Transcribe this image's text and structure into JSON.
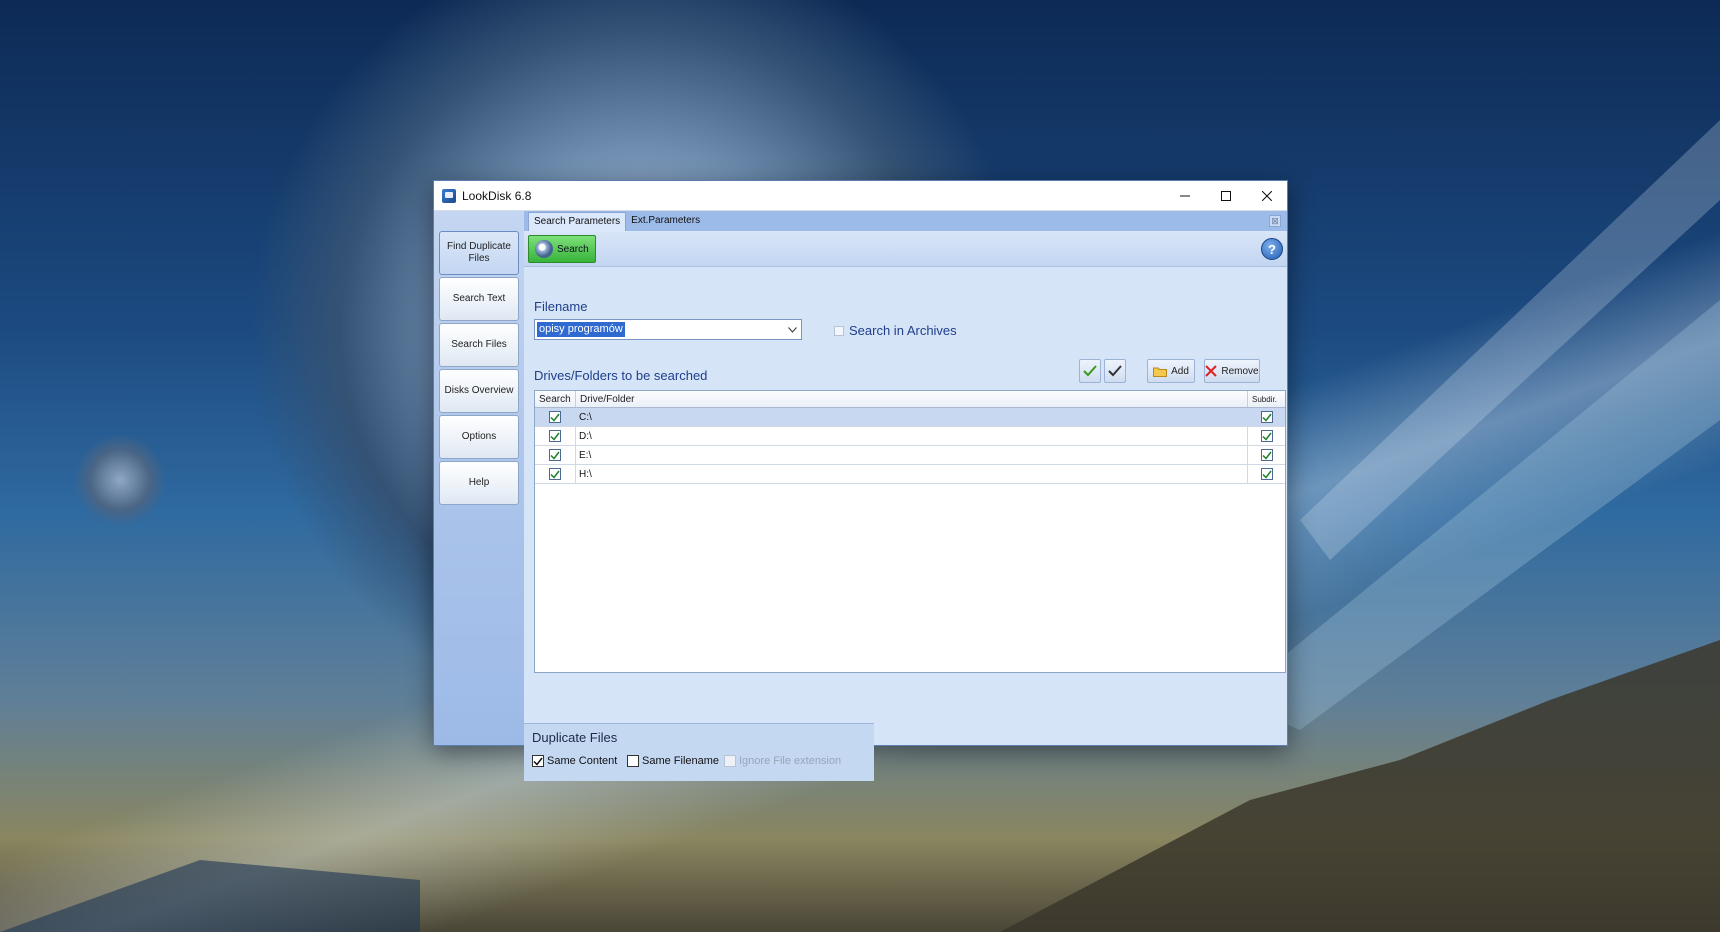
{
  "window": {
    "title": "LookDisk 6.8"
  },
  "nav": {
    "items": [
      {
        "label": "Find Duplicate Files",
        "active": true
      },
      {
        "label": "Search Text"
      },
      {
        "label": "Search Files"
      },
      {
        "label": "Disks Overview"
      },
      {
        "label": "Options"
      },
      {
        "label": "Help"
      }
    ]
  },
  "tabs": [
    {
      "label": "Search Parameters",
      "active": true
    },
    {
      "label": "Ext.Parameters"
    }
  ],
  "toolbar": {
    "search_label": "Search",
    "help_label": "?"
  },
  "filename": {
    "label": "Filename",
    "value": "opisy programów"
  },
  "search_in_archives": {
    "label": "Search in Archives",
    "checked": false
  },
  "drives": {
    "label": "Drives/Folders to be searched",
    "add_label": "Add",
    "remove_label": "Remove",
    "columns": [
      "Search",
      "Drive/Folder",
      "Subdir."
    ],
    "rows": [
      {
        "search": true,
        "folder": "C:\\",
        "subdir": true
      },
      {
        "search": true,
        "folder": "D:\\",
        "subdir": true
      },
      {
        "search": true,
        "folder": "E:\\",
        "subdir": true
      },
      {
        "search": true,
        "folder": "H:\\",
        "subdir": true
      }
    ]
  },
  "duplicate_files": {
    "title": "Duplicate Files",
    "same_content": {
      "label": "Same Content",
      "checked": true
    },
    "same_filename": {
      "label": "Same Filename",
      "checked": false
    },
    "ignore_extension": {
      "label": "Ignore File extension",
      "checked": false,
      "disabled": true
    }
  },
  "colors": {
    "accent": "#2f6ad0",
    "search_button": "#37b33a",
    "label_blue": "#1e3f8a"
  }
}
